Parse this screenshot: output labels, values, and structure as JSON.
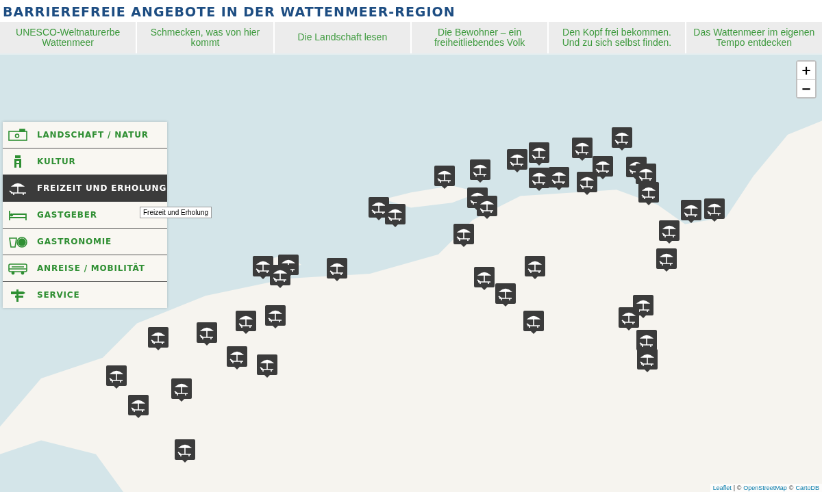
{
  "title": "BARRIEREFREIE ANGEBOTE IN DER WATTENMEER-REGION",
  "tabs": [
    {
      "label": "UNESCO-Weltnaturerbe Wattenmeer"
    },
    {
      "label": "Schmecken, was von hier kommt"
    },
    {
      "label": "Die Landschaft lesen"
    },
    {
      "label": "Die Bewohner – ein freiheitliebendes Volk"
    },
    {
      "label": "Den Kopf frei bekommen. Und zu sich selbst finden."
    },
    {
      "label": "Das Wattenmeer im eigenen Tempo entdecken"
    }
  ],
  "map": {
    "zoom_controls": [
      "+",
      "−"
    ],
    "categories": [
      {
        "label": "LANDSCHAFT / NATUR",
        "selected": false
      },
      {
        "label": "KULTUR",
        "selected": false
      },
      {
        "label": "FREIZEIT UND ERHOLUNG",
        "selected": true
      },
      {
        "label": "GASTGEBER",
        "selected": false
      },
      {
        "label": "GASTRONOMIE",
        "selected": false
      },
      {
        "label": "ANREISE / MOBILITÄT",
        "selected": false
      },
      {
        "label": "SERVICE",
        "selected": false
      }
    ],
    "tooltip": "Freizeit und Erholung",
    "attribution": {
      "leaflet": "Leaflet",
      "separator": "| ©",
      "osm": "OpenStreetMap",
      "copy": "©",
      "carto": "CartoDB"
    }
  }
}
